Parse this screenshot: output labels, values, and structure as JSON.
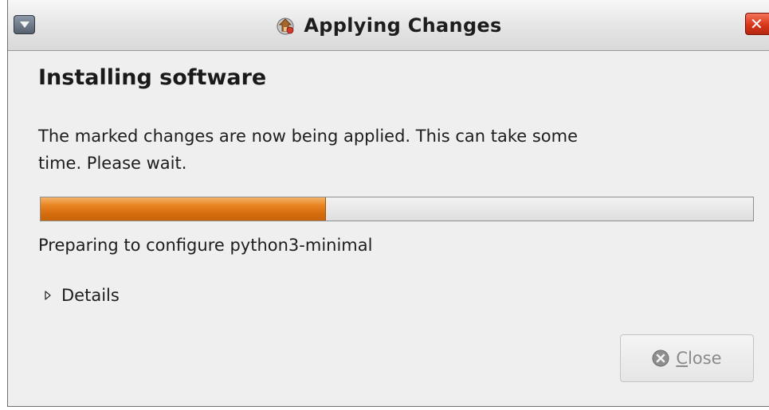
{
  "window": {
    "title": "Applying Changes",
    "icons": {
      "menu": "window-menu-icon",
      "app": "package-installer-icon",
      "close": "close-x-icon"
    }
  },
  "main": {
    "heading": "Installing software",
    "description": "The marked changes are now being applied. This can take some time. Please wait.",
    "progress": {
      "percent": 40,
      "fill_color": "#e07a16",
      "track_color": "#e6e6e6"
    },
    "status_text": "Preparing to configure python3-minimal",
    "details_label": "Details",
    "details_icon": "expander-arrow-icon"
  },
  "buttons": {
    "close": {
      "mnemonic": "C",
      "rest": "lose",
      "enabled": false,
      "icon": "close-circle-icon"
    }
  },
  "colors": {
    "titlebar_close": "#d83618",
    "window_bg": "#efefef"
  }
}
